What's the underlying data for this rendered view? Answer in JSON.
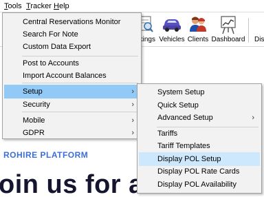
{
  "menubar": {
    "tools": "Tools",
    "tracker": "Tracker",
    "help": "Help"
  },
  "toolbar": {
    "bookings_label": "kings",
    "vehicles_label": "Vehicles",
    "clients_label": "Clients",
    "dashboard_label": "Dashboard",
    "display_label": "Disp"
  },
  "tools_menu": {
    "items": [
      "Central Reservations Monitor",
      "Search For Note",
      "Custom Data Export",
      "Post to Accounts",
      "Import Account Balances",
      "Setup",
      "Security",
      "Mobile",
      "GDPR"
    ]
  },
  "setup_menu": {
    "items": [
      "System Setup",
      "Quick Setup",
      "Advanced Setup",
      "Tariffs",
      "Tariff Templates",
      "Display POL Setup",
      "Display POL Rate Cards",
      "Display POL Availability"
    ]
  },
  "page": {
    "platform_text": "ROHIRE PLATFORM",
    "hero_text": "oin us for a look"
  },
  "colors": {
    "menu_bg": "#f2f2f2",
    "highlight_active": "#91c9f7",
    "highlight_hover": "#cde8fc",
    "platform_blue": "#3b6fd6"
  },
  "icons": {
    "submenu_arrow": "›"
  }
}
